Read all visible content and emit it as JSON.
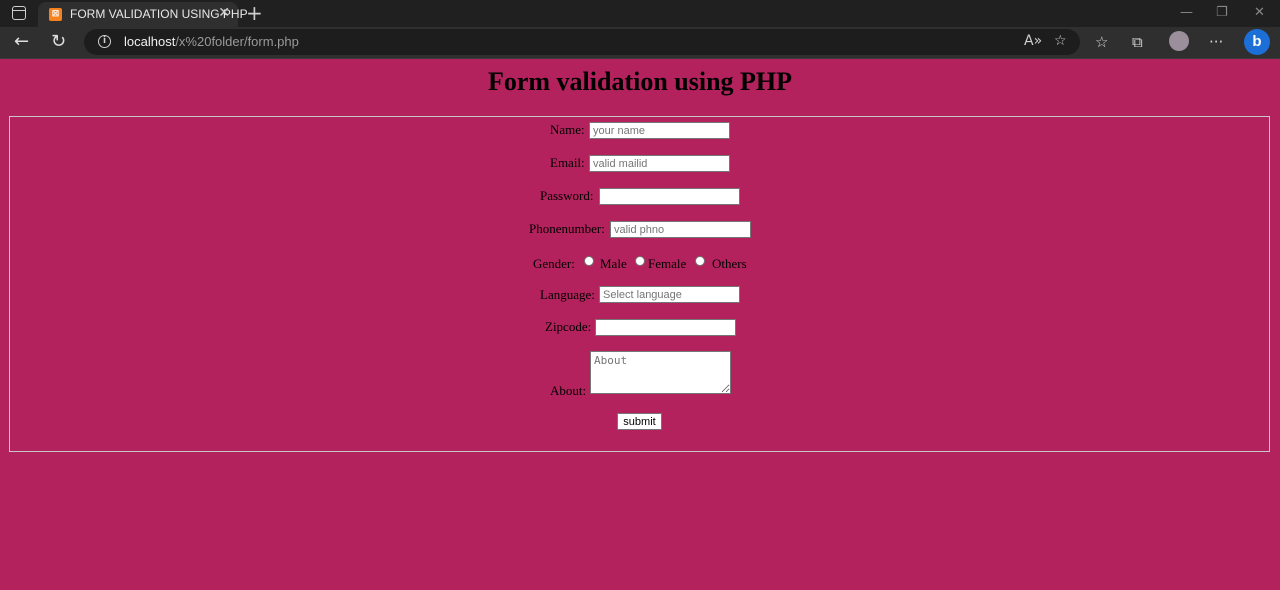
{
  "browser": {
    "tab_title": "FORM VALIDATION USING PHP",
    "url_host": "localhost",
    "url_path": "/x%20folder/form.php"
  },
  "page": {
    "heading": "Form validation using PHP"
  },
  "form": {
    "name_label": "Name:",
    "name_placeholder": "your name",
    "email_label": "Email:",
    "email_placeholder": "valid mailid",
    "password_label": "Password:",
    "phone_label": "Phonenumber:",
    "phone_placeholder": "valid phno",
    "gender_label": "Gender:",
    "gender_options": [
      "Male",
      "Female",
      "Others"
    ],
    "language_label": "Language:",
    "language_placeholder": "Select language",
    "zipcode_label": "Zipcode:",
    "about_label": "About:",
    "about_placeholder": "About",
    "submit_label": "submit"
  },
  "colors": {
    "page_background": "#b3225c"
  }
}
